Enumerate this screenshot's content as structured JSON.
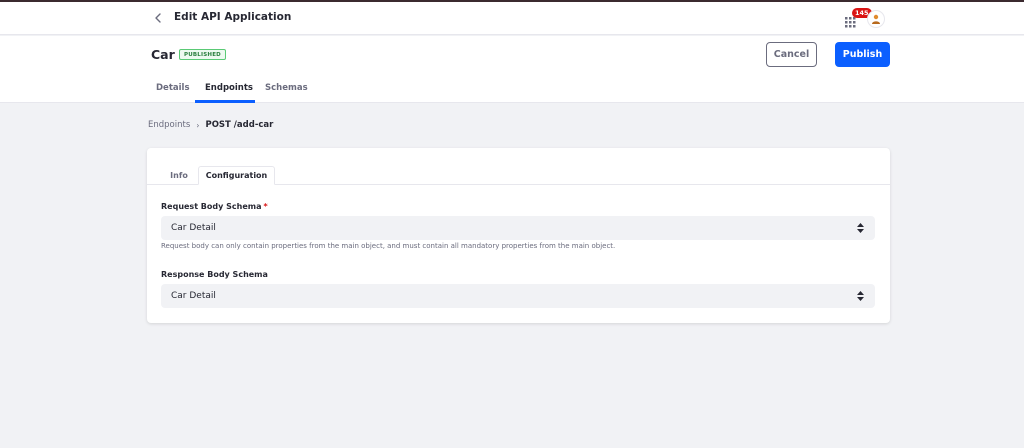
{
  "topbar": {
    "title": "Edit API Application",
    "notification_count": "145"
  },
  "header": {
    "app_name": "Car",
    "status": "PUBLISHED",
    "cancel_label": "Cancel",
    "publish_label": "Publish",
    "tabs": [
      {
        "label": "Details",
        "active": false
      },
      {
        "label": "Endpoints",
        "active": true
      },
      {
        "label": "Schemas",
        "active": false
      }
    ]
  },
  "breadcrumb": {
    "parent": "Endpoints",
    "current": "POST /add-car"
  },
  "card": {
    "tabs": [
      {
        "label": "Info",
        "active": false
      },
      {
        "label": "Configuration",
        "active": true
      }
    ],
    "request_schema": {
      "label": "Request Body Schema",
      "required_mark": "*",
      "value": "Car Detail",
      "help": "Request body can only contain properties from the main object, and must contain all mandatory properties from the main object."
    },
    "response_schema": {
      "label": "Response Body Schema",
      "value": "Car Detail"
    }
  },
  "colors": {
    "primary": "#0b5fff",
    "badge_red": "#da1414",
    "published_green": "#287d3c",
    "background": "#f1f2f5"
  },
  "icons": [
    "chevron-left-icon",
    "apps-grid-icon",
    "user-avatar-icon",
    "select-arrows-icon",
    "breadcrumb-chevron-icon"
  ]
}
